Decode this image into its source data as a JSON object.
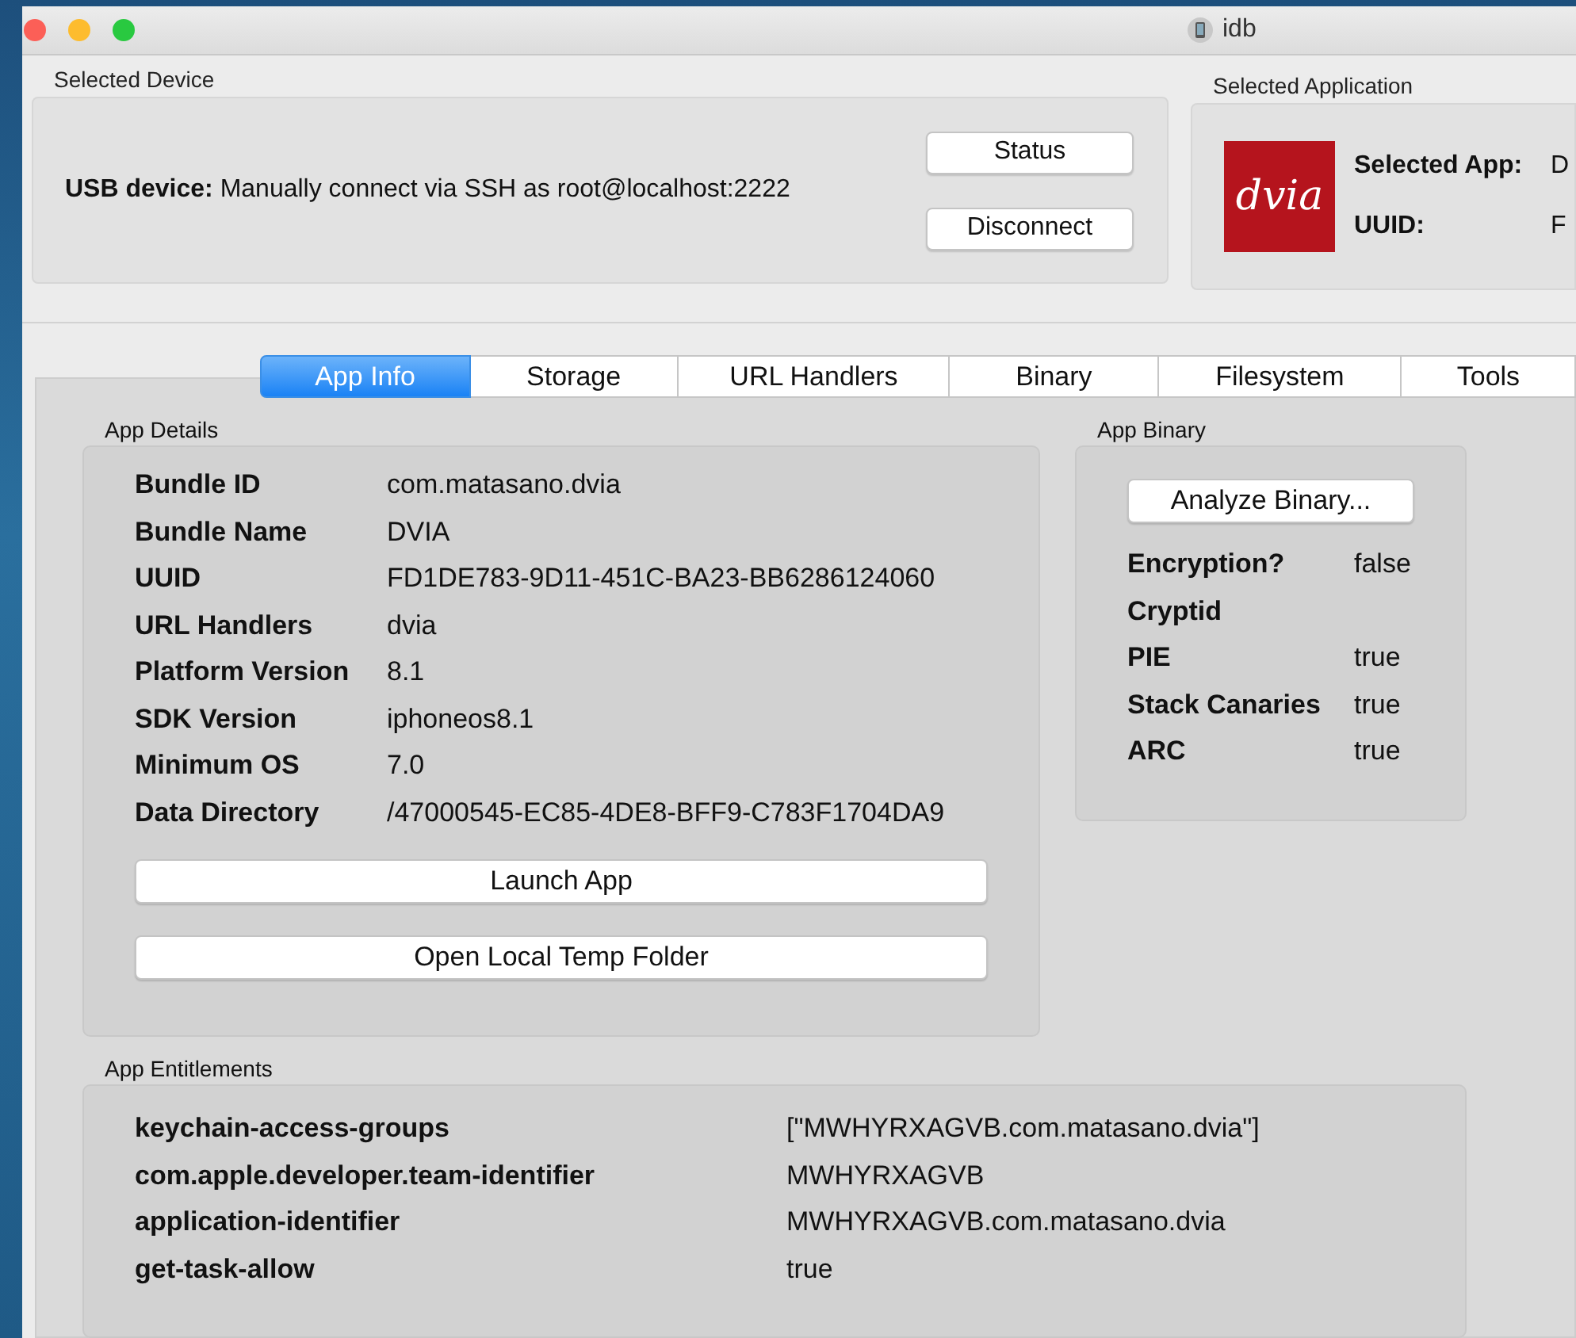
{
  "window": {
    "title": "idb"
  },
  "selected_device": {
    "title": "Selected Device",
    "label": "USB device:",
    "text": "Manually connect via SSH as root@localhost:2222",
    "buttons": [
      "Status",
      "Disconnect"
    ]
  },
  "selected_application": {
    "title": "Selected Application",
    "logo": "dvia",
    "fields": [
      {
        "label": "Selected App:",
        "value": "D"
      },
      {
        "label": "UUID:",
        "value": "F"
      }
    ]
  },
  "tabs": [
    {
      "label": "App Info",
      "selected": true
    },
    {
      "label": "Storage",
      "selected": false
    },
    {
      "label": "URL Handlers",
      "selected": false
    },
    {
      "label": "Binary",
      "selected": false
    },
    {
      "label": "Filesystem",
      "selected": false
    },
    {
      "label": "Tools",
      "selected": false
    }
  ],
  "app_details": {
    "title": "App Details",
    "rows": [
      {
        "label": "Bundle ID",
        "value": "com.matasano.dvia"
      },
      {
        "label": "Bundle Name",
        "value": "DVIA"
      },
      {
        "label": "UUID",
        "value": "FD1DE783-9D11-451C-BA23-BB6286124060"
      },
      {
        "label": "URL Handlers",
        "value": "dvia"
      },
      {
        "label": "Platform Version",
        "value": "8.1"
      },
      {
        "label": "SDK Version",
        "value": "iphoneos8.1"
      },
      {
        "label": "Minimum OS",
        "value": "7.0"
      },
      {
        "label": "Data Directory",
        "value": "/47000545-EC85-4DE8-BFF9-C783F1704DA9"
      }
    ],
    "buttons": [
      "Launch App",
      "Open Local Temp Folder"
    ]
  },
  "app_binary": {
    "title": "App Binary",
    "button": "Analyze Binary...",
    "rows": [
      {
        "label": "Encryption?",
        "value": "false"
      },
      {
        "label": "Cryptid"
      },
      {
        "label": "PIE",
        "value": "true"
      },
      {
        "label": "Stack Canaries",
        "value": "true"
      },
      {
        "label": "ARC",
        "value": "true"
      }
    ]
  },
  "app_entitlements": {
    "title": "App Entitlements",
    "rows": [
      {
        "label": "keychain-access-groups",
        "value": "[\"MWHYRXAGVB.com.matasano.dvia\"]"
      },
      {
        "label": "com.apple.developer.team-identifier",
        "value": "MWHYRXAGVB"
      },
      {
        "label": "application-identifier",
        "value": "MWHYRXAGVB.com.matasano.dvia"
      },
      {
        "label": "get-task-allow",
        "value": "true"
      }
    ]
  }
}
